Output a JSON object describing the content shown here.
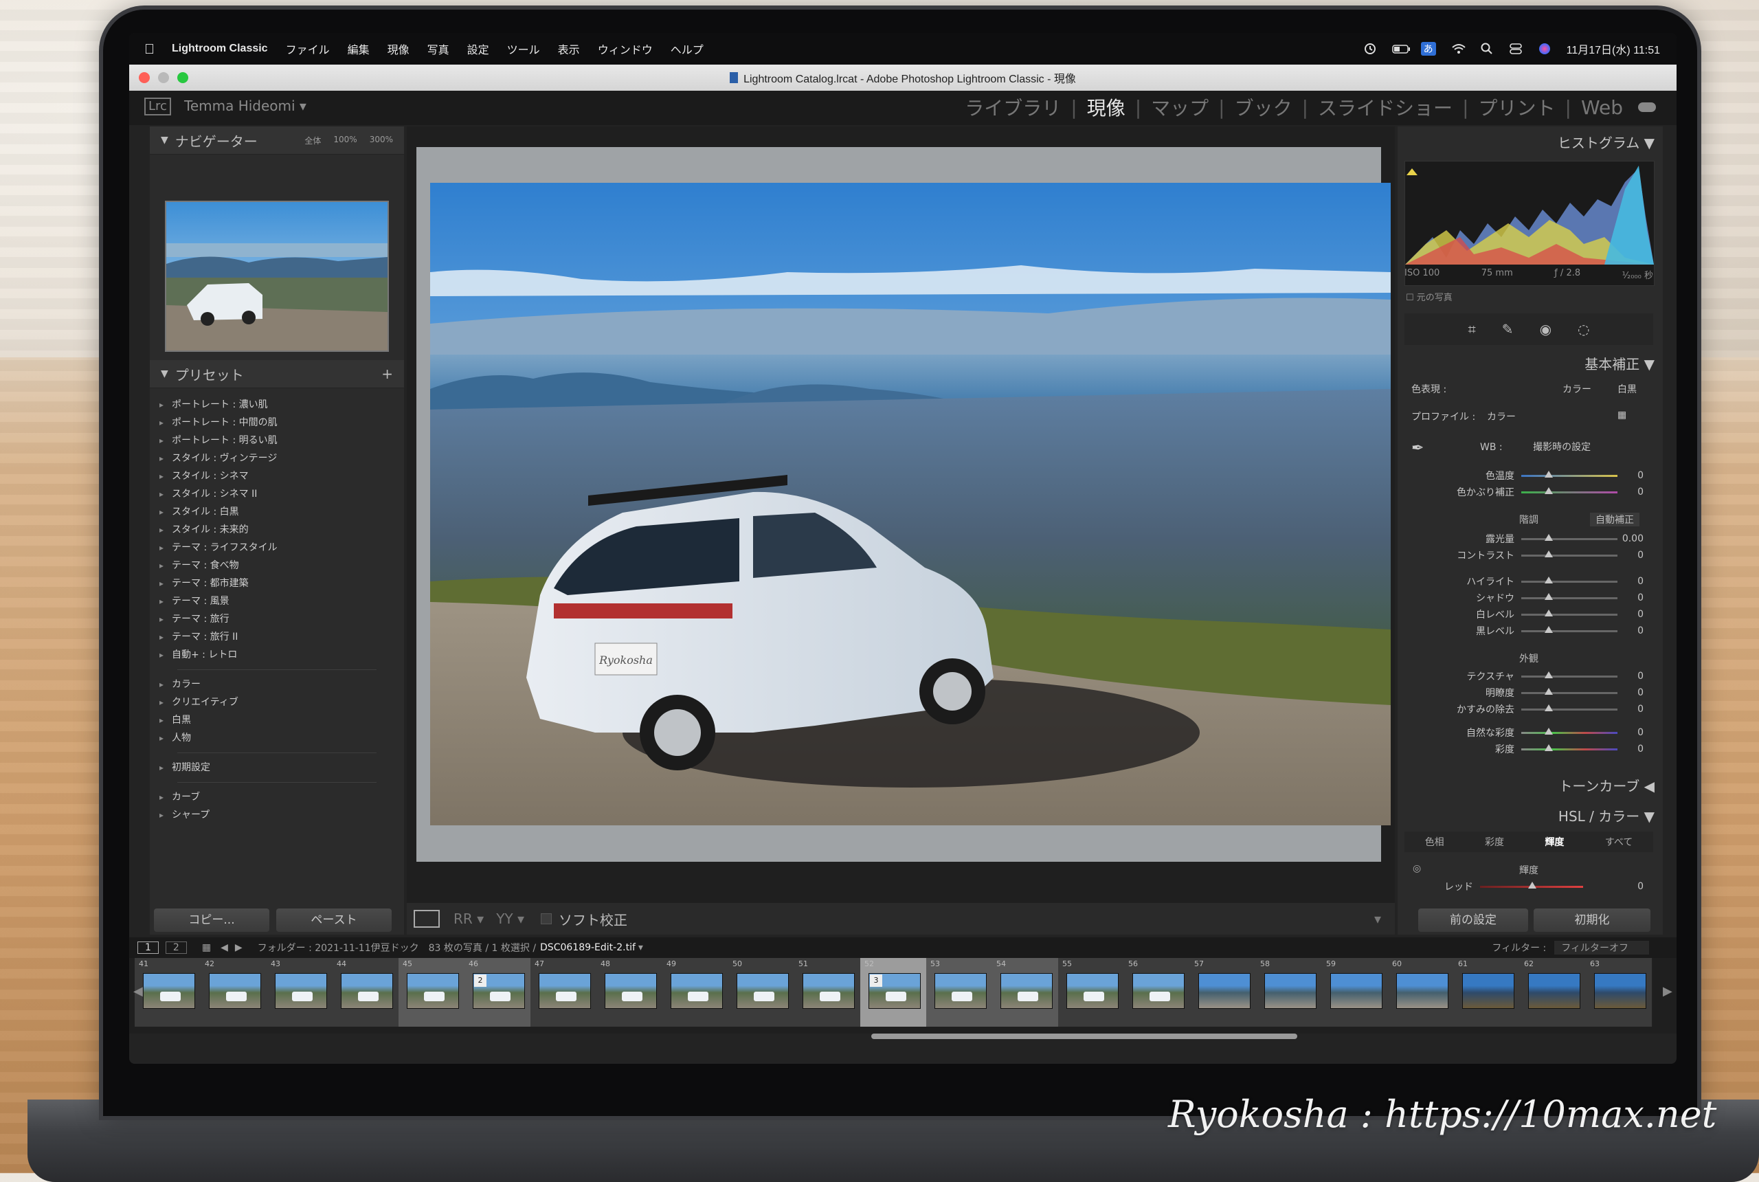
{
  "menubar": {
    "app_name": "Lightroom Classic",
    "items": [
      "ファイル",
      "編集",
      "現像",
      "写真",
      "設定",
      "ツール",
      "表示",
      "ウィンドウ",
      "ヘルプ"
    ],
    "input_method": "あ",
    "datetime": "11月17日(水) 11:51"
  },
  "titlebar": {
    "title": "Lightroom Catalog.lrcat - Adobe Photoshop Lightroom Classic - 現像"
  },
  "identity": {
    "logo": "Lrc",
    "user": "Temma Hideomi"
  },
  "modules": [
    "ライブラリ",
    "現像",
    "マップ",
    "ブック",
    "スライドショー",
    "プリント",
    "Web"
  ],
  "active_module": "現像",
  "navigator": {
    "title": "ナビゲーター",
    "zoom": [
      "全体",
      "100%",
      "300%"
    ]
  },
  "presets": {
    "title": "プリセット",
    "group1": [
      "ポートレート : 濃い肌",
      "ポートレート : 中間の肌",
      "ポートレート : 明るい肌",
      "スタイル : ヴィンテージ",
      "スタイル : シネマ",
      "スタイル : シネマ II",
      "スタイル : 白黒",
      "スタイル : 未来的",
      "テーマ : ライフスタイル",
      "テーマ : 食べ物",
      "テーマ : 都市建築",
      "テーマ : 風景",
      "テーマ : 旅行",
      "テーマ : 旅行 II",
      "自動+ : レトロ"
    ],
    "group2": [
      "カラー",
      "クリエイティブ",
      "白黒",
      "人物"
    ],
    "group3": [
      "初期設定"
    ],
    "group4": [
      "カーブ",
      "シャープ"
    ]
  },
  "left_buttons": {
    "copy": "コピー...",
    "paste": "ペースト"
  },
  "center_toolbar": {
    "soft_proof": "ソフト校正"
  },
  "photo": {
    "plate": "Ryokosha"
  },
  "histogram": {
    "title": "ヒストグラム",
    "iso": "ISO 100",
    "focal": "75 mm",
    "aperture": "ƒ / 2.8",
    "shutter": "¹⁄₂₀₀₀ 秒",
    "original": "元の写真"
  },
  "basic": {
    "title": "基本補正",
    "treatment_label": "色表現 :",
    "color": "カラー",
    "bw": "白黒",
    "profile_label": "プロファイル :",
    "profile": "カラー",
    "wb_label": "WB :",
    "wb": "撮影時の設定",
    "tone_head": "階調",
    "auto": "自動補正",
    "presence_head": "外観"
  },
  "sliders": [
    {
      "label": "色温度",
      "value": "0"
    },
    {
      "label": "色かぶり補正",
      "value": "0"
    },
    {
      "label": "露光量",
      "value": "0.00"
    },
    {
      "label": "コントラスト",
      "value": "0"
    },
    {
      "label": "ハイライト",
      "value": "0"
    },
    {
      "label": "シャドウ",
      "value": "0"
    },
    {
      "label": "白レベル",
      "value": "0"
    },
    {
      "label": "黒レベル",
      "value": "0"
    },
    {
      "label": "テクスチャ",
      "value": "0"
    },
    {
      "label": "明瞭度",
      "value": "0"
    },
    {
      "label": "かすみの除去",
      "value": "0"
    },
    {
      "label": "自然な彩度",
      "value": "0"
    },
    {
      "label": "彩度",
      "value": "0"
    }
  ],
  "tone_curve": {
    "title": "トーンカーブ"
  },
  "hsl": {
    "title": "HSL / カラー",
    "tabs": [
      "色相",
      "彩度",
      "輝度",
      "すべて"
    ],
    "active_tab": "輝度",
    "sub": "輝度",
    "row_label": "レッド",
    "row_value": "0"
  },
  "right_buttons": {
    "previous": "前の設定",
    "reset": "初期化"
  },
  "filmstrip": {
    "pages": [
      "1",
      "2"
    ],
    "path": "フォルダー : 2021-11-11伊豆ドック",
    "count": "83 枚の写真 / 1 枚選択 /",
    "file": "DSC06189-Edit-2.tif",
    "filter_label": "フィルター :",
    "filter_value": "フィルターオフ",
    "numbers": [
      "41",
      "42",
      "43",
      "44",
      "45",
      "46",
      "47",
      "48",
      "49",
      "50",
      "51",
      "52",
      "53",
      "54",
      "55",
      "56",
      "57",
      "58",
      "59",
      "60",
      "61",
      "62",
      "63"
    ],
    "selected": "52",
    "selected_badge": "3",
    "badge_46": "2"
  },
  "watermark": "Ryokosha : https://10max.net"
}
